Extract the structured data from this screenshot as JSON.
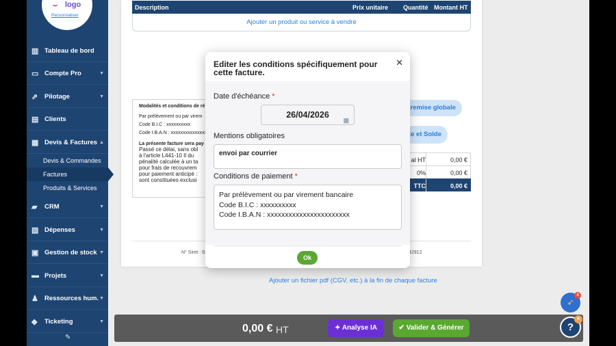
{
  "sidebar": {
    "logo_text": "logo",
    "logo_edit": "Personnaliser",
    "items": [
      {
        "label": "Tableau de bord",
        "icon": "chart-icon"
      },
      {
        "label": "Compte Pro",
        "icon": "bank-icon"
      },
      {
        "label": "Pilotage",
        "icon": "trend-icon"
      },
      {
        "label": "Clients",
        "icon": "contacts-icon"
      },
      {
        "label": "Devis & Factures",
        "icon": "document-icon"
      },
      {
        "label": "CRM",
        "icon": "briefcase-icon"
      },
      {
        "label": "Dépenses",
        "icon": "receipt-icon"
      },
      {
        "label": "Gestion de stock",
        "icon": "box-icon"
      },
      {
        "label": "Projets",
        "icon": "folder-icon"
      },
      {
        "label": "Ressources hum.",
        "icon": "people-icon"
      },
      {
        "label": "Ticketing",
        "icon": "ticket-icon"
      }
    ],
    "subitems": [
      "Devis & Commandes",
      "Factures",
      "Produits & Services"
    ]
  },
  "document": {
    "columns": {
      "description": "Description",
      "unit_price": "Prix unitaire",
      "quantity": "Quantité",
      "amount_ht": "Montant HT"
    },
    "add_row": "Ajouter un produit ou service à vendre",
    "terms_title": "Modalités et conditions de ré",
    "terms_lines": [
      "Par prélèvement ou par virem",
      "Code B.I.C : xxxxxxxxxx",
      "Code I.B.A.N : xxxxxxxxxxxxxxx"
    ],
    "late_title": "La présente facture sera pay",
    "late_lines": [
      "Passé ce délai, sans obl",
      "à l'article L441-10 Il du",
      "pénalité calculée à un ta",
      "pour frais de recouvrem",
      "pour paiement anticipé :",
      "sont constituées exclusi"
    ],
    "btn_remise": "remise globale",
    "btn_acompte": "te et Solde",
    "totals": [
      {
        "label": "al HT",
        "value": "0,00 €"
      },
      {
        "label": "0%",
        "value": "0,00 €"
      },
      {
        "label": "TTC",
        "value": "0,00 €"
      }
    ],
    "siret": "N° Siret : 92",
    "siret_end": "42912",
    "pdf_link": "Ajouter un fichier pdf (CGV, etc.) à la fin de chaque facture"
  },
  "modal": {
    "title": "Editer les conditions spécifiquement pour cette facture.",
    "due_label": "Date d'échéance",
    "due_value": "26/04/2026",
    "mentions_label": "Mentions obligatoires",
    "mentions_value": "envoi par courrier",
    "conditions_label": "Conditions de paiement",
    "conditions_lines": [
      "Par prélèvement ou par virement bancaire",
      "Code B.I.C : xxxxxxxxxx",
      "Code I.B.A.N : xxxxxxxxxxxxxxxxxxxxxxx"
    ],
    "required_mark": "*",
    "ok_label": "Ok"
  },
  "bottom": {
    "price": "0,00 €",
    "price_unit": "HT",
    "btn_ia": "Analyse IA",
    "btn_valider": "Valider & Générer"
  },
  "fab": {
    "badge_count": "4",
    "help": "?"
  },
  "colors": {
    "primary": "#1e4472",
    "accent": "#2a7de1",
    "success": "#5aa832",
    "ai": "#6c2fd6",
    "required": "#d93025"
  }
}
